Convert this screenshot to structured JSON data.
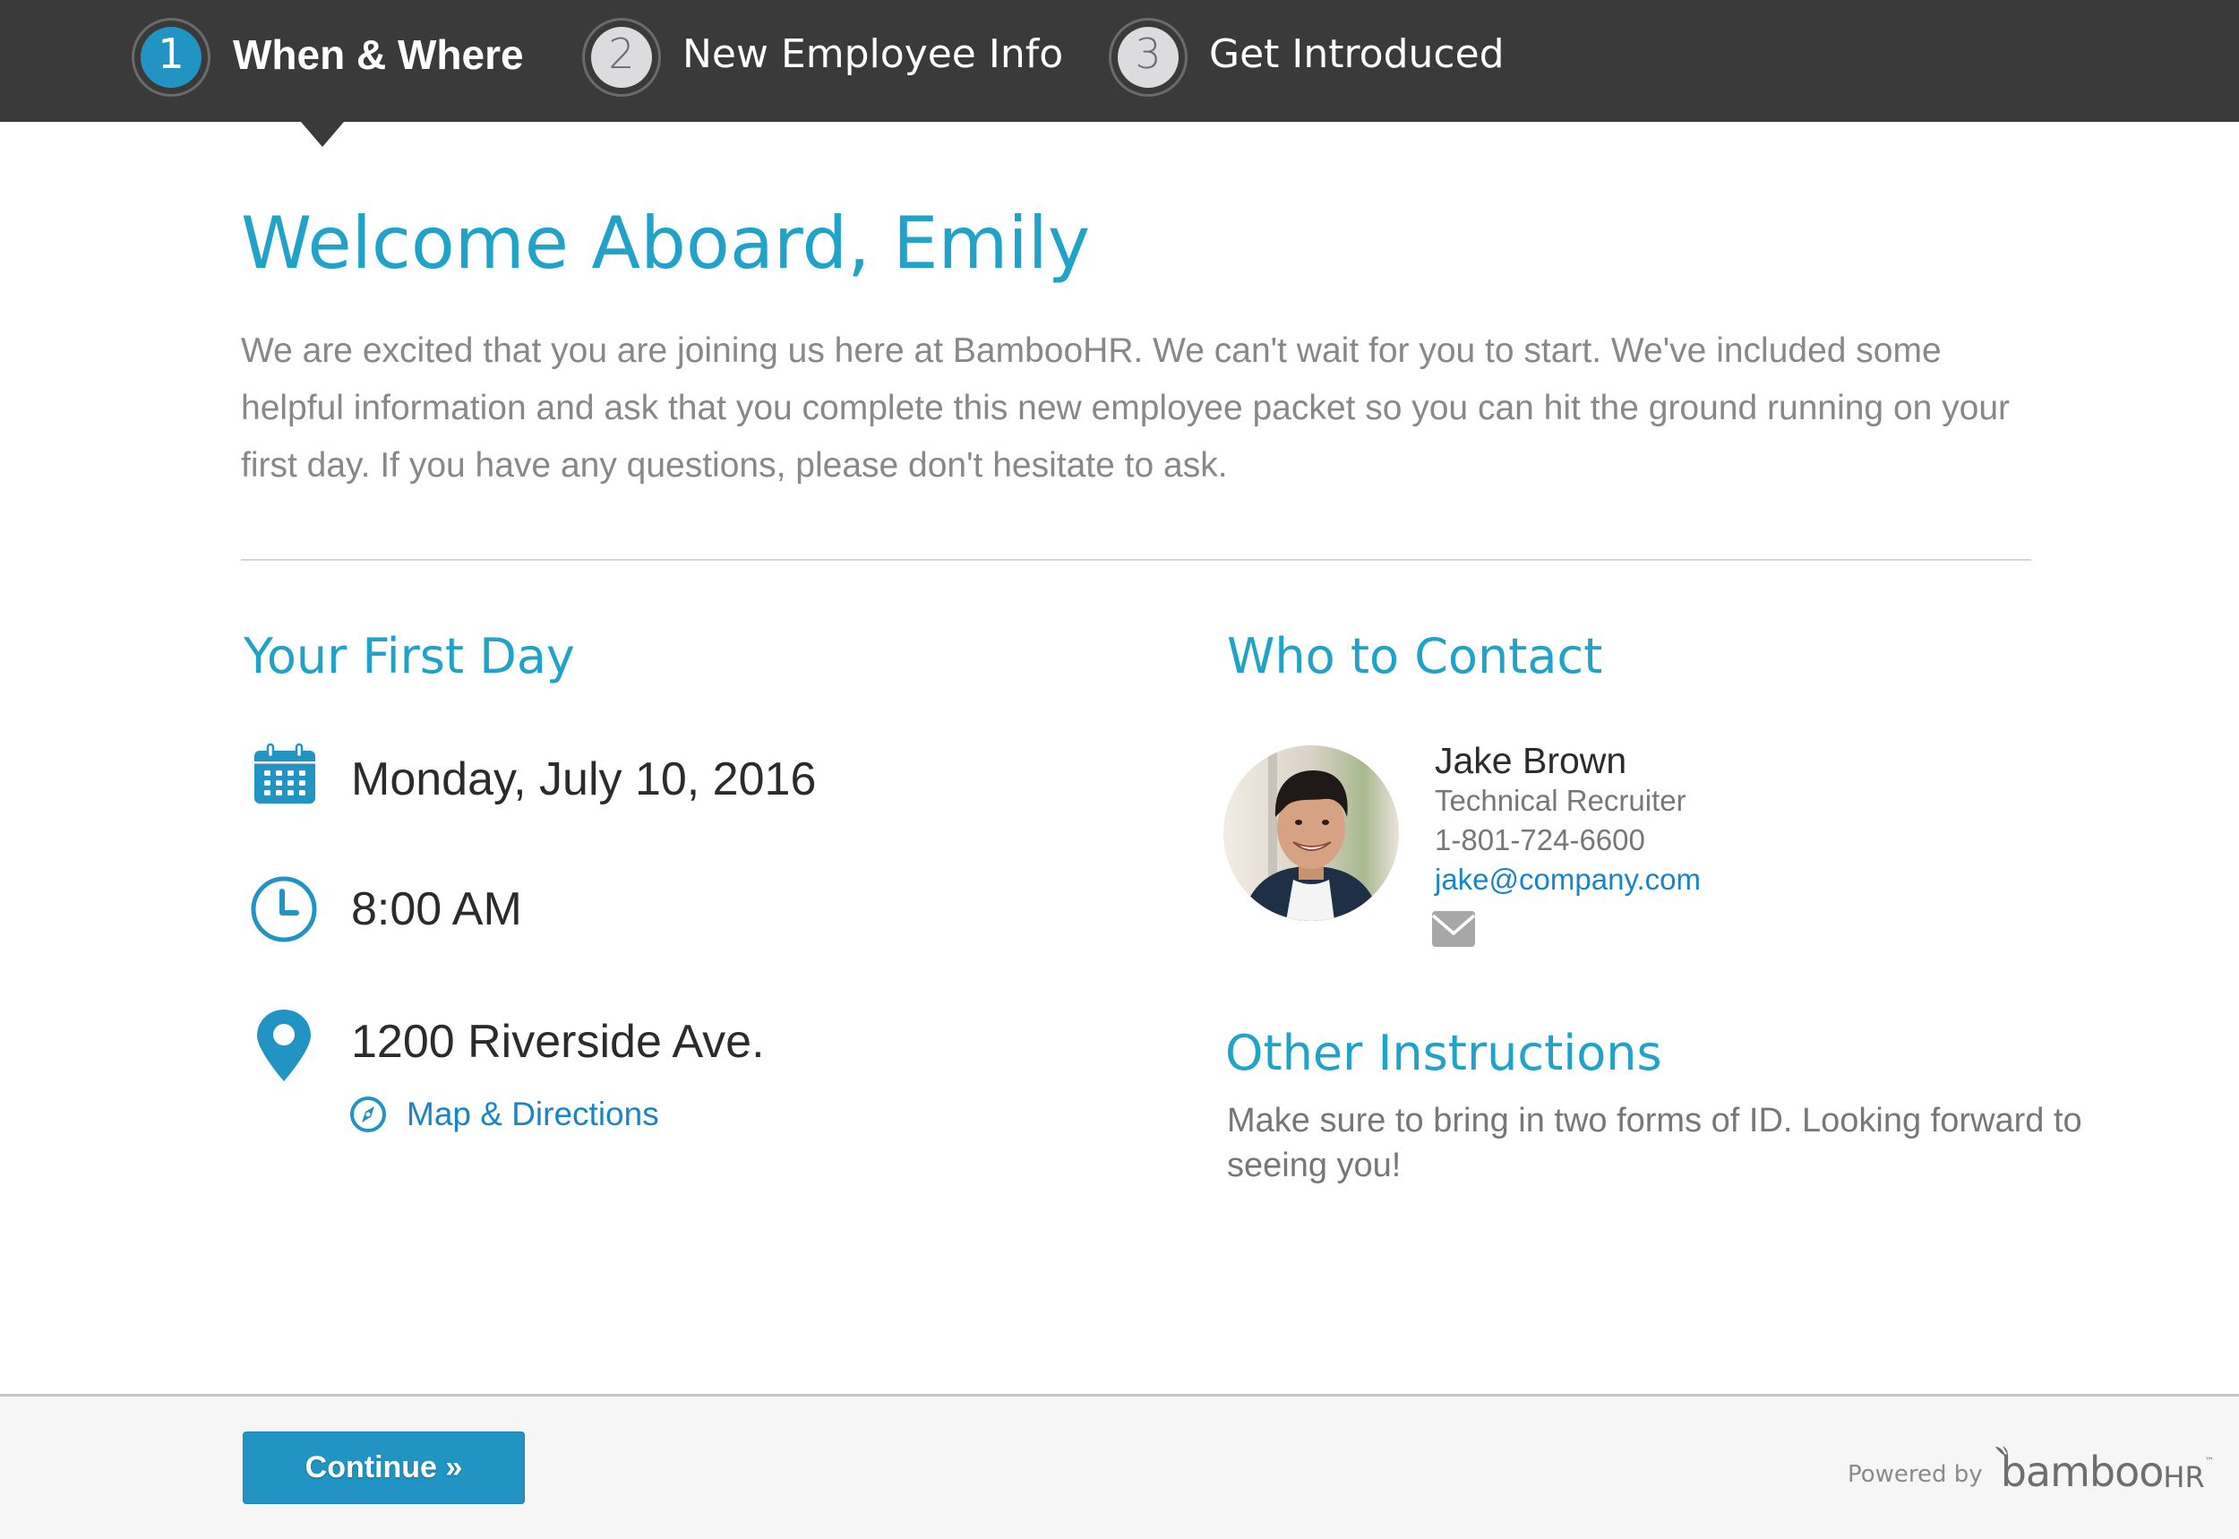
{
  "steps": [
    {
      "number": "1",
      "label": "When & Where",
      "state": "active"
    },
    {
      "number": "2",
      "label": "New Employee Info",
      "state": "inactive"
    },
    {
      "number": "3",
      "label": "Get Introduced",
      "state": "inactive"
    }
  ],
  "welcome": {
    "title": "Welcome Aboard, Emily",
    "message": "We are excited that you are joining us here at BambooHR. We can't wait for you to start. We've included some helpful information and ask that you complete this new employee packet so you can hit the ground running on your first day. If you have any questions, please don't hesitate to ask."
  },
  "first_day": {
    "heading": "Your First Day",
    "date": "Monday, July 10, 2016",
    "time": "8:00 AM",
    "address": "1200 Riverside Ave.",
    "map_link_label": "Map & Directions",
    "icons": {
      "date": "calendar-icon",
      "time": "clock-icon",
      "address": "map-pin-icon",
      "map": "compass-icon"
    }
  },
  "contact": {
    "heading": "Who to Contact",
    "name": "Jake Brown",
    "title": "Technical Recruiter",
    "phone": "1-801-724-6600",
    "email": "jake@company.com",
    "avatar_alt": "Jake Brown photo",
    "mail_icon": "envelope-icon"
  },
  "instructions": {
    "heading": "Other Instructions",
    "text": "Make sure to bring in two forms of ID. Looking forward to seeing you!"
  },
  "footer": {
    "continue_label": "Continue »",
    "powered_by": "Powered by",
    "brand_main": "bamboo",
    "brand_suffix": "HR",
    "brand_tm": "™"
  },
  "colors": {
    "accent": "#20a2c9",
    "button": "#2194c3",
    "link": "#1a84c7",
    "header_bg": "#3a3a3a",
    "footer_bg": "#f6f6f6"
  }
}
